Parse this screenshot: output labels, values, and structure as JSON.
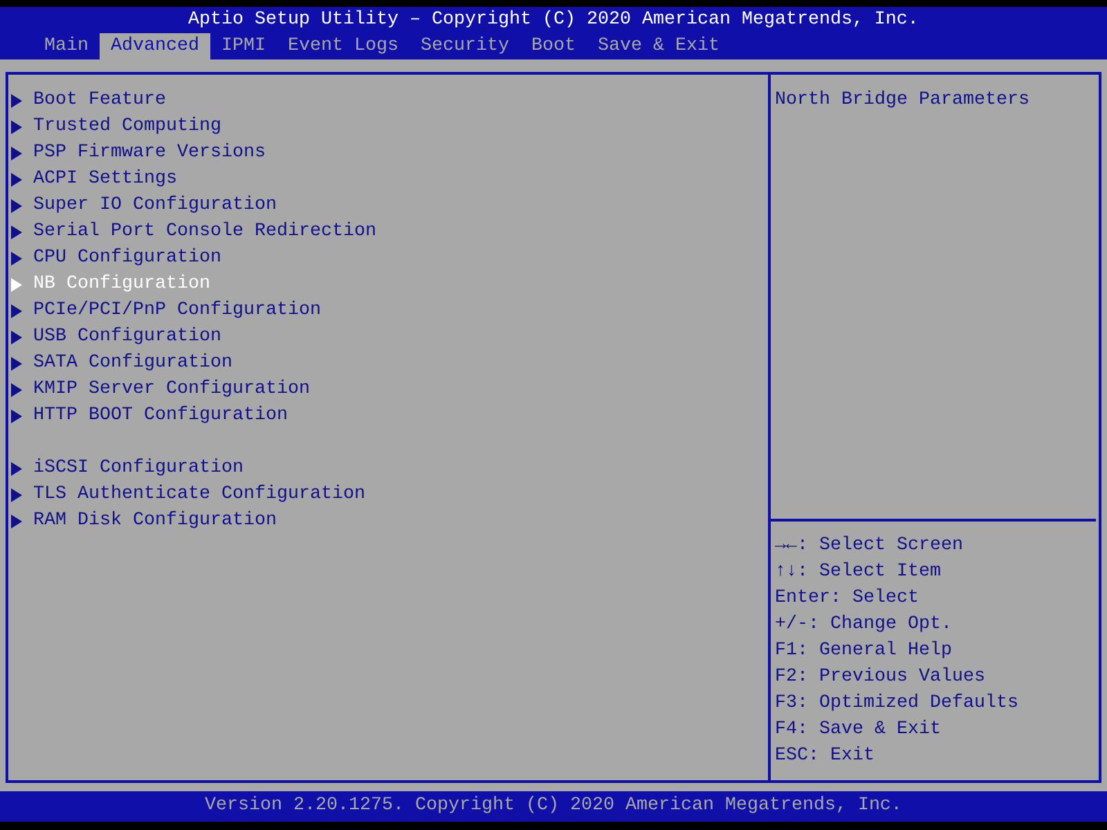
{
  "title": "Aptio Setup Utility – Copyright (C) 2020 American Megatrends, Inc.",
  "tabs": [
    {
      "label": "Main",
      "selected": false
    },
    {
      "label": "Advanced",
      "selected": true
    },
    {
      "label": "IPMI",
      "selected": false
    },
    {
      "label": "Event Logs",
      "selected": false
    },
    {
      "label": "Security",
      "selected": false
    },
    {
      "label": "Boot",
      "selected": false
    },
    {
      "label": "Save & Exit",
      "selected": false
    }
  ],
  "menu_groups": [
    {
      "items": [
        {
          "label": "Boot Feature",
          "selected": false
        },
        {
          "label": "Trusted Computing",
          "selected": false
        },
        {
          "label": "PSP Firmware Versions",
          "selected": false
        },
        {
          "label": "ACPI Settings",
          "selected": false
        },
        {
          "label": "Super IO Configuration",
          "selected": false
        },
        {
          "label": "Serial Port Console Redirection",
          "selected": false
        },
        {
          "label": "CPU Configuration",
          "selected": false
        },
        {
          "label": "NB Configuration",
          "selected": true
        },
        {
          "label": "PCIe/PCI/PnP Configuration",
          "selected": false
        },
        {
          "label": "USB Configuration",
          "selected": false
        },
        {
          "label": "SATA Configuration",
          "selected": false
        },
        {
          "label": "KMIP Server Configuration",
          "selected": false
        },
        {
          "label": "HTTP BOOT Configuration",
          "selected": false
        }
      ]
    },
    {
      "items": [
        {
          "label": "iSCSI Configuration",
          "selected": false
        },
        {
          "label": "TLS Authenticate Configuration",
          "selected": false
        },
        {
          "label": "RAM Disk Configuration",
          "selected": false
        }
      ]
    }
  ],
  "help_text": "North Bridge Parameters",
  "key_help": [
    "→←: Select Screen",
    "↑↓: Select Item",
    "Enter: Select",
    "+/-: Change Opt.",
    "F1: General Help",
    "F2: Previous Values",
    "F3: Optimized Defaults",
    "F4: Save & Exit",
    "ESC: Exit"
  ],
  "footer": "Version 2.20.1275. Copyright (C) 2020 American Megatrends, Inc."
}
